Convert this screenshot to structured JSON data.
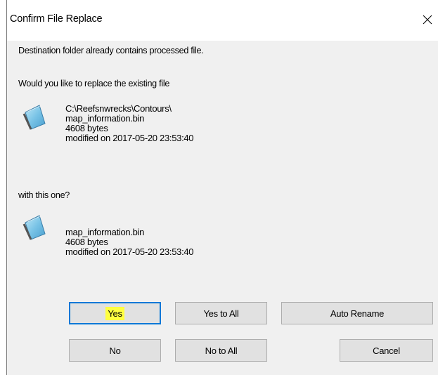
{
  "window": {
    "title": "Confirm File Replace",
    "close_glyph": "✕"
  },
  "message": {
    "line1": "Destination folder already contains processed file.",
    "line2": "Would you like to replace the existing file",
    "line3": "with this one?"
  },
  "existing_file": {
    "icon": "notepad-file-icon",
    "path": "C:\\Reefsnwrecks\\Contours\\",
    "name": "map_information.bin",
    "size": "4608 bytes",
    "modified": "modified on 2017-05-20 23:53:40"
  },
  "new_file": {
    "icon": "notepad-file-icon",
    "name": "map_information.bin",
    "size": "4608 bytes",
    "modified": "modified on 2017-05-20 23:53:40"
  },
  "buttons": {
    "yes": "Yes",
    "yes_to_all": "Yes to All",
    "auto_rename": "Auto Rename",
    "no": "No",
    "no_to_all": "No to All",
    "cancel": "Cancel"
  },
  "colors": {
    "accent": "#0078d7",
    "highlight": "#ffff40",
    "dialog_background": "#f0f0f0",
    "button_face": "#e1e1e1"
  }
}
